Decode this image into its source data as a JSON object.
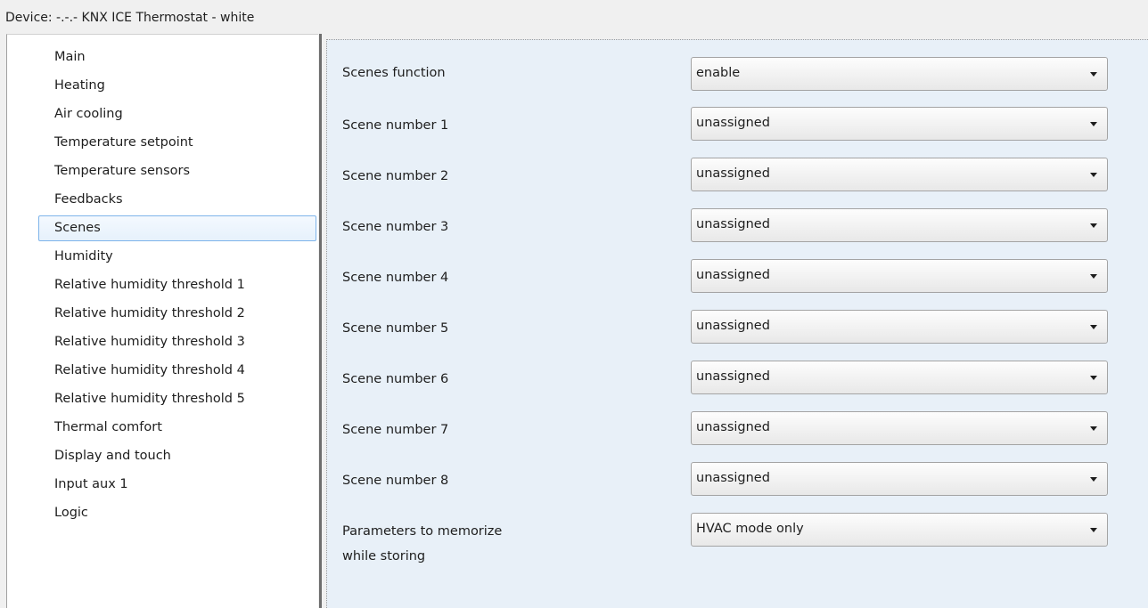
{
  "window": {
    "title": "Device: -.-.-  KNX ICE Thermostat - white"
  },
  "sidebar": {
    "selected_index": 6,
    "items": [
      {
        "label": "Main"
      },
      {
        "label": "Heating"
      },
      {
        "label": "Air cooling"
      },
      {
        "label": "Temperature setpoint"
      },
      {
        "label": "Temperature sensors"
      },
      {
        "label": "Feedbacks"
      },
      {
        "label": "Scenes"
      },
      {
        "label": "Humidity"
      },
      {
        "label": "Relative humidity threshold 1"
      },
      {
        "label": "Relative humidity threshold 2"
      },
      {
        "label": "Relative humidity threshold 3"
      },
      {
        "label": "Relative humidity threshold 4"
      },
      {
        "label": "Relative humidity threshold 5"
      },
      {
        "label": "Thermal comfort"
      },
      {
        "label": "Display and touch"
      },
      {
        "label": "Input aux 1"
      },
      {
        "label": "Logic"
      }
    ]
  },
  "params": [
    {
      "label": "Scenes function",
      "value": "enable"
    },
    {
      "label": "Scene number 1",
      "value": "unassigned"
    },
    {
      "label": "Scene number 2",
      "value": "unassigned"
    },
    {
      "label": "Scene number 3",
      "value": "unassigned"
    },
    {
      "label": "Scene number 4",
      "value": "unassigned"
    },
    {
      "label": "Scene number 5",
      "value": "unassigned"
    },
    {
      "label": "Scene number 6",
      "value": "unassigned"
    },
    {
      "label": "Scene number 7",
      "value": "unassigned"
    },
    {
      "label": "Scene number 8",
      "value": "unassigned"
    },
    {
      "label": "Parameters to memorize\nwhile storing",
      "value": "HVAC mode only"
    }
  ],
  "icons": {
    "dropdown_arrow": "chevron-down-icon"
  }
}
